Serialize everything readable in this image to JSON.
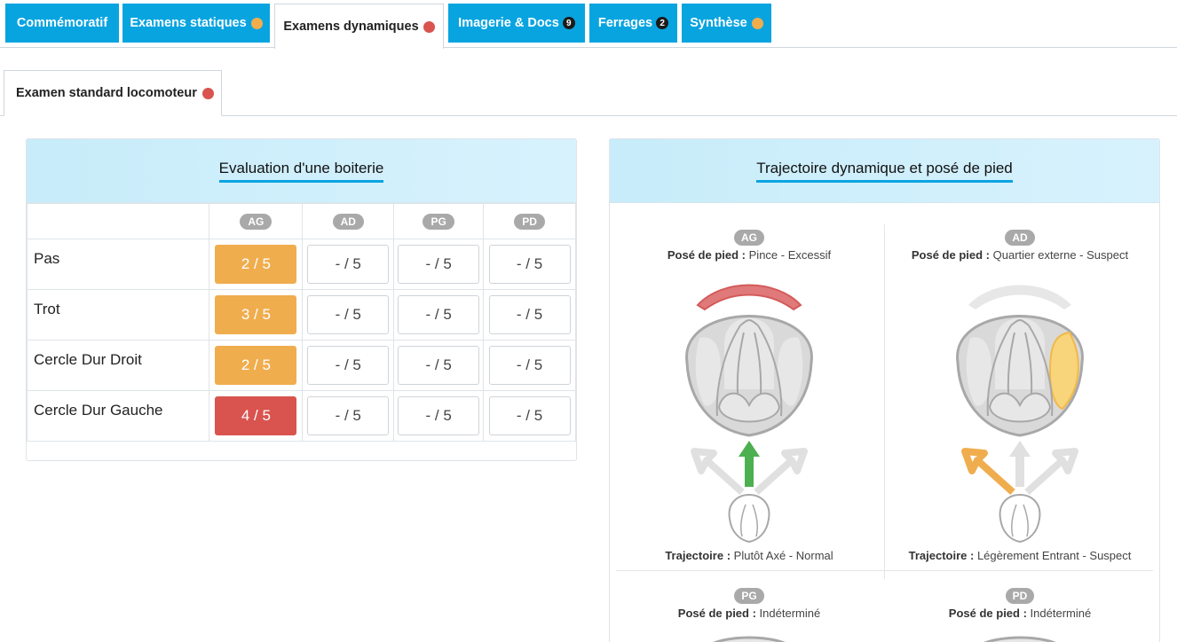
{
  "top_tabs": [
    {
      "label": "Commémoratif"
    },
    {
      "label": "Examens statiques",
      "dot_color": "#f0ad4e"
    },
    {
      "label": "Examens dynamiques",
      "dot_color": "#d9534f"
    },
    {
      "label": "Imagerie & Docs",
      "count": "9"
    },
    {
      "label": "Ferrages",
      "count": "2"
    },
    {
      "label": "Synthèse",
      "dot_color": "#f0ad4e"
    }
  ],
  "sub_tab": {
    "label": "Examen standard locomoteur",
    "dot_color": "#d9534f"
  },
  "evaluation": {
    "title": "Evaluation d'une boiterie",
    "columns": [
      "AG",
      "AD",
      "PG",
      "PD"
    ],
    "rows": [
      {
        "label": "Pas",
        "scores": [
          "2 / 5",
          "- / 5",
          "- / 5",
          "- / 5"
        ]
      },
      {
        "label": "Trot",
        "scores": [
          "3 / 5",
          "- / 5",
          "- / 5",
          "- / 5"
        ]
      },
      {
        "label": "Cercle Dur Droit",
        "scores": [
          "2 / 5",
          "- / 5",
          "- / 5",
          "- / 5"
        ]
      },
      {
        "label": "Cercle Dur Gauche",
        "scores": [
          "4 / 5",
          "- / 5",
          "- / 5",
          "- / 5"
        ]
      }
    ],
    "severity": [
      "orange",
      "orange",
      "orange",
      "red"
    ]
  },
  "trajectory": {
    "title": "Trajectoire dynamique et posé de pied",
    "pose_label": "Posé de pied :",
    "traj_label": "Trajectoire :",
    "cells": [
      {
        "badge": "AG",
        "pose": "Pince - Excessif",
        "traj": "Plutôt Axé - Normal"
      },
      {
        "badge": "AD",
        "pose": "Quartier externe - Suspect",
        "traj": "Légèrement Entrant - Suspect"
      },
      {
        "badge": "PG",
        "pose": "Indéterminé"
      },
      {
        "badge": "PD",
        "pose": "Indéterminé"
      }
    ]
  },
  "colors": {
    "tab_blue": "#08a4e0",
    "orange": "#f0ad4e",
    "red": "#d9534f",
    "green": "#4cb050",
    "excessif": "#e07a7a",
    "suspect": "#f8d47a"
  }
}
